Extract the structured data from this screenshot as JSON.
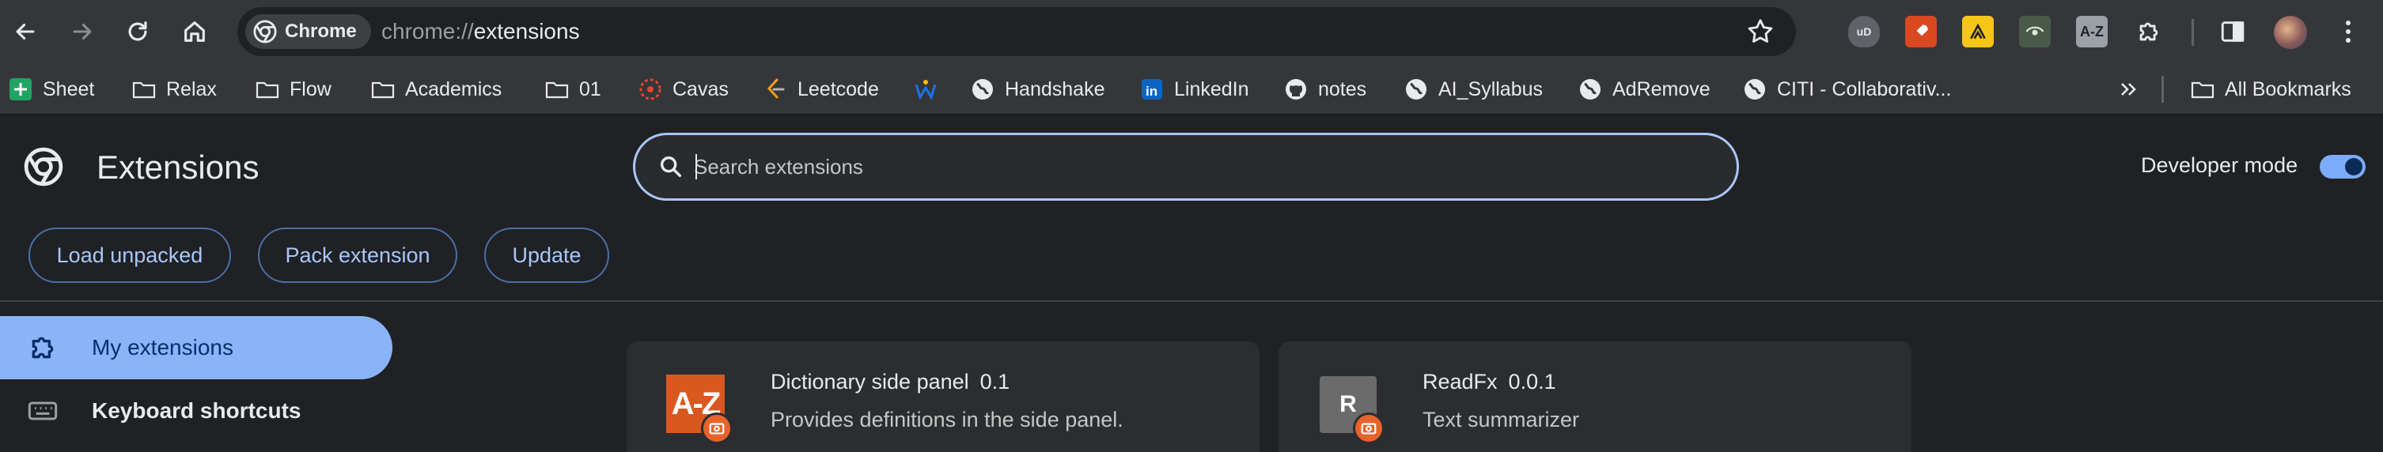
{
  "toolbar": {
    "chip_label": "Chrome",
    "url_scheme": "chrome://",
    "url_path": "extensions",
    "extension_icons": [
      "ublock-icon",
      "rocket-icon",
      "caution-icon",
      "eye-icon",
      "a-z-icon",
      "puzzle-icon"
    ],
    "ext_labels": {
      "ublock": "uD",
      "az": "A-Z"
    }
  },
  "bookmarks": [
    {
      "label": "Sheet",
      "icon": "sheets-icon"
    },
    {
      "label": "Relax",
      "icon": "folder-icon"
    },
    {
      "label": "Flow",
      "icon": "folder-icon"
    },
    {
      "label": "Academics",
      "icon": "folder-icon"
    },
    {
      "label": "01",
      "icon": "folder-icon"
    },
    {
      "label": "Cavas",
      "icon": "canvas-icon"
    },
    {
      "label": "Leetcode",
      "icon": "leetcode-icon"
    },
    {
      "label": "",
      "icon": "w-icon"
    },
    {
      "label": "Handshake",
      "icon": "globe-icon"
    },
    {
      "label": "LinkedIn",
      "icon": "linkedin-icon"
    },
    {
      "label": "notes",
      "icon": "github-icon"
    },
    {
      "label": "AI_Syllabus",
      "icon": "globe-icon"
    },
    {
      "label": "AdRemove",
      "icon": "globe-icon"
    },
    {
      "label": "CITI - Collaborativ...",
      "icon": "globe-icon"
    }
  ],
  "bookmarks_all": "All Bookmarks",
  "header": {
    "title": "Extensions",
    "search_placeholder": "Search extensions",
    "developer_mode_label": "Developer mode",
    "developer_mode_on": true
  },
  "actions": {
    "load_unpacked": "Load unpacked",
    "pack_extension": "Pack extension",
    "update": "Update"
  },
  "sidebar": {
    "items": [
      {
        "label": "My extensions",
        "active": true
      },
      {
        "label": "Keyboard shortcuts",
        "active": false
      }
    ]
  },
  "extensions": [
    {
      "name": "Dictionary side panel",
      "version": "0.1",
      "description": "Provides definitions in the side panel.",
      "logo_text": "A-Z"
    },
    {
      "name": "ReadFx",
      "version": "0.0.1",
      "description": "Text summarizer",
      "logo_text": "R"
    }
  ],
  "colors": {
    "accent": "#a8c7fa",
    "active_nav": "#8ab4f8",
    "badge": "#e8632b"
  }
}
